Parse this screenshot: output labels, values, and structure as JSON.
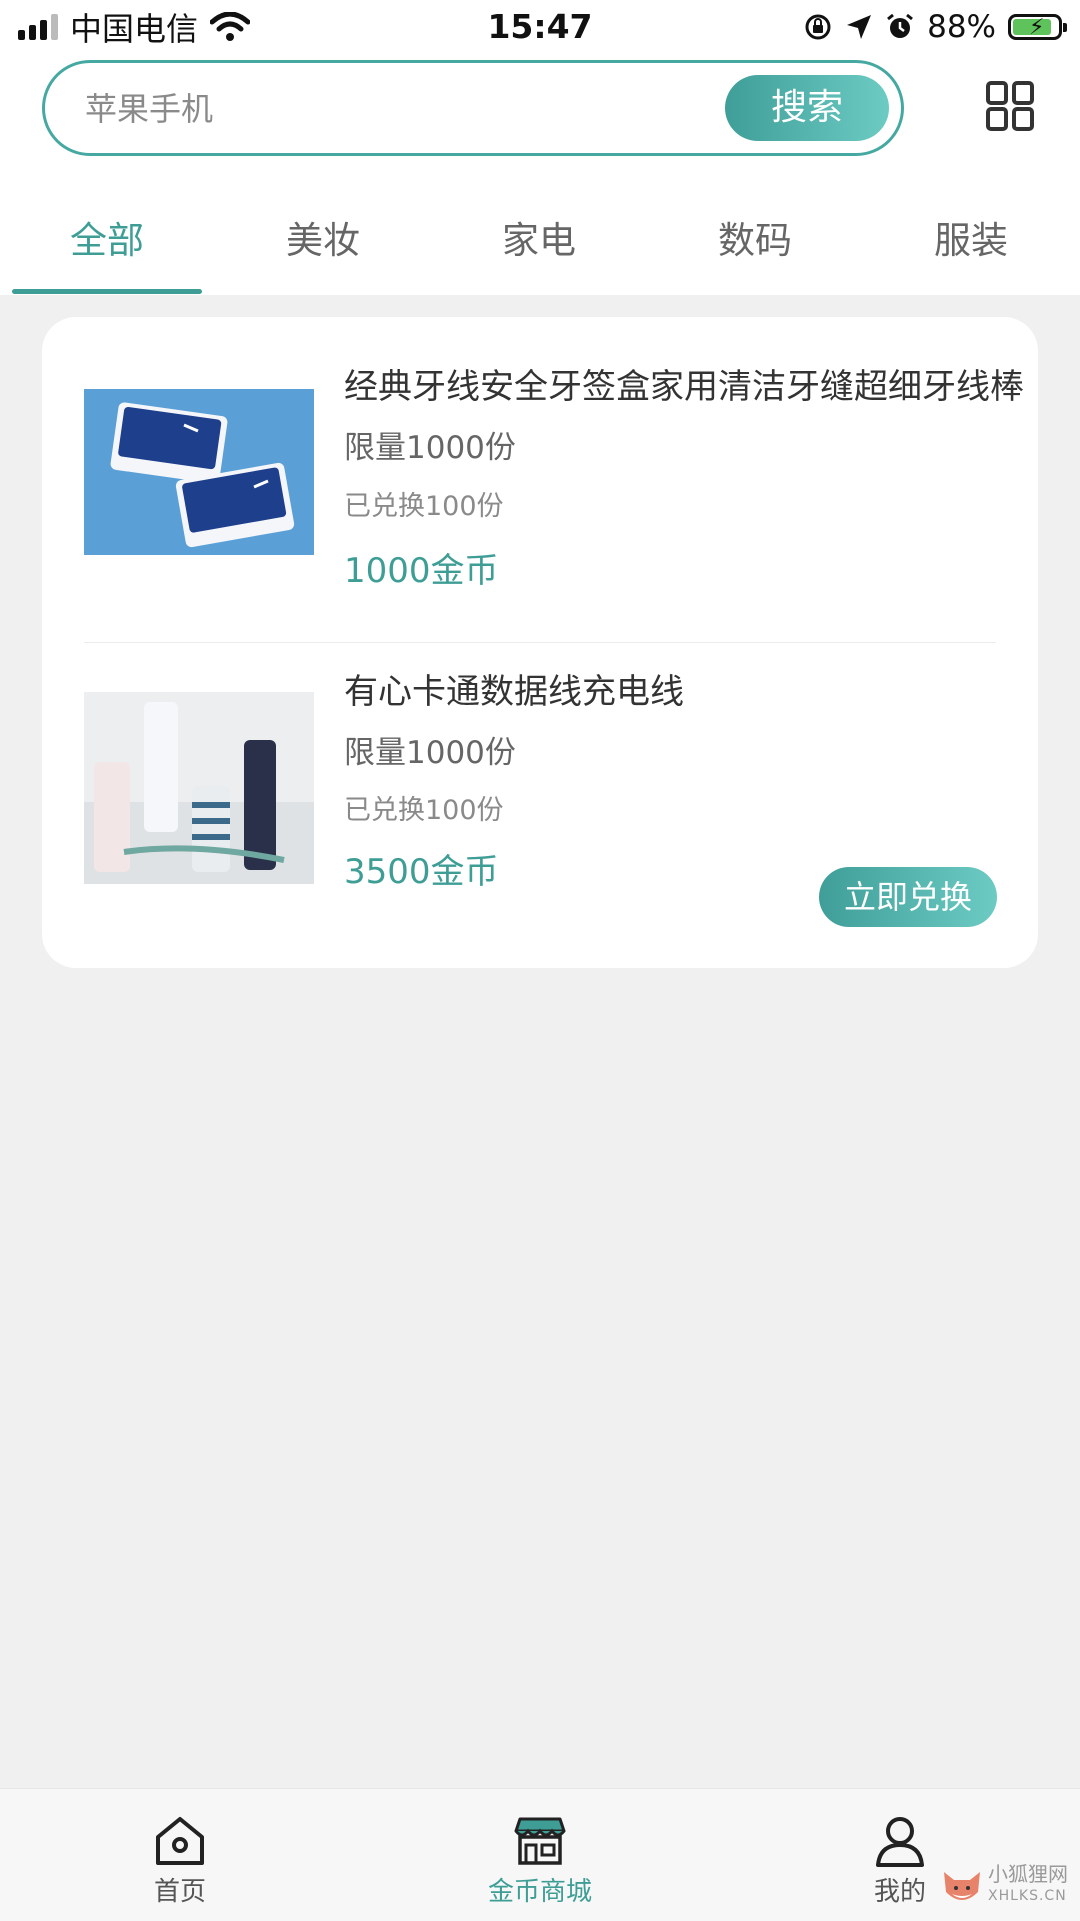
{
  "status_bar": {
    "carrier": "中国电信",
    "time": "15:47",
    "battery_percent": "88%",
    "signal_bars": 4,
    "icons": [
      "wifi-icon",
      "orientation-lock-icon",
      "location-icon",
      "alarm-icon",
      "battery-charging-icon"
    ]
  },
  "search": {
    "placeholder": "苹果手机",
    "button_label": "搜索",
    "grid_icon": "grid-view-icon"
  },
  "tabs": [
    {
      "label": "全部",
      "active": true
    },
    {
      "label": "美妆",
      "active": false
    },
    {
      "label": "家电",
      "active": false
    },
    {
      "label": "数码",
      "active": false
    },
    {
      "label": "服装",
      "active": false
    }
  ],
  "products": [
    {
      "title": "经典牙线安全牙签盒家用清洁牙缝超细牙线棒",
      "limit": "限量1000份",
      "exchanged": "已兑换100份",
      "price": "1000金币",
      "image": "dental-floss-box-image"
    },
    {
      "title": "有心卡通数据线充电线",
      "limit": "限量1000份",
      "exchanged": "已兑换100份",
      "price": "3500金币",
      "image": "cartoon-charging-cable-image",
      "button_label": "立即兑换"
    }
  ],
  "bottom_nav": [
    {
      "label": "首页",
      "icon": "home-icon",
      "active": false
    },
    {
      "label": "金币商城",
      "icon": "store-icon",
      "active": true
    },
    {
      "label": "我的",
      "icon": "user-icon",
      "active": false
    }
  ],
  "watermark": {
    "line1": "小狐狸网",
    "line2": "XHLKS.CN"
  },
  "colors": {
    "accent": "#3e9e96",
    "background": "#f0f0f0",
    "card": "#ffffff"
  }
}
